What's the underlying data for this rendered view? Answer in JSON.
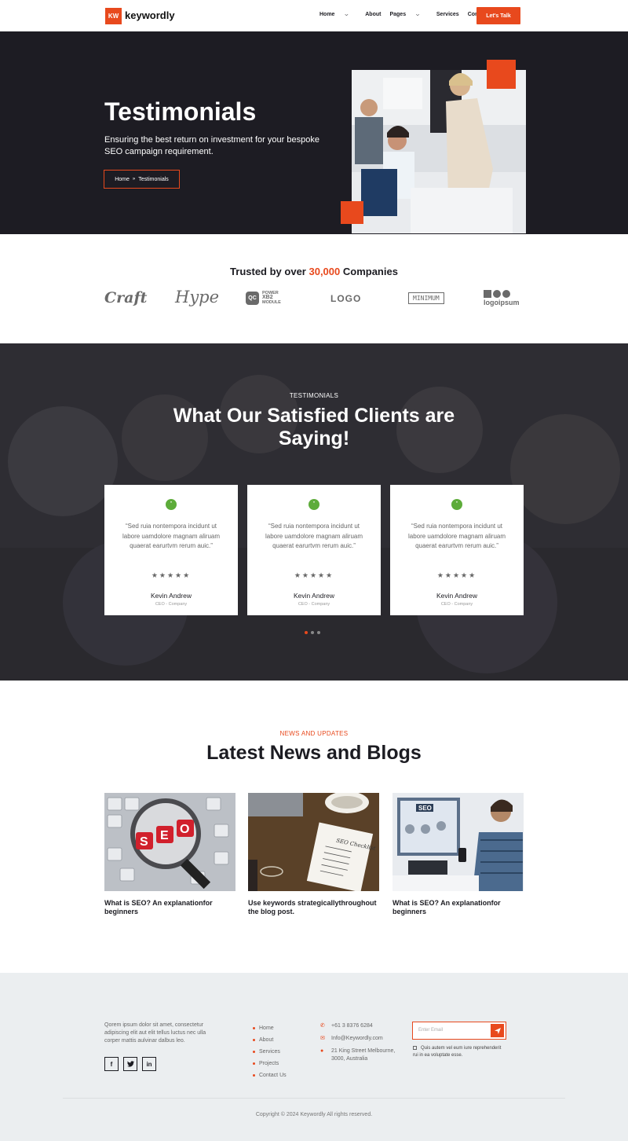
{
  "header": {
    "logo_mark": "KW",
    "logo_text": "keywordly",
    "nav": [
      "Home",
      "About",
      "Pages",
      "Services",
      "Contact"
    ],
    "cta": "Let's Talk"
  },
  "hero": {
    "title": "Testimonials",
    "subtitle": "Ensuring the best return on investment for your bespoke SEO campaign requirement.",
    "breadcrumb_home": "Home",
    "breadcrumb_sep": "»",
    "breadcrumb_current": "Testimonials"
  },
  "trusted": {
    "prefix": "Trusted by over",
    "number": "30,000",
    "suffix": "Companies"
  },
  "brands": [
    "Craft",
    "Hype",
    "QC",
    "POWER",
    "XB2",
    "MODULE",
    "LOGO",
    "MINIMUM",
    "logoipsum"
  ],
  "testimonials": {
    "eyebrow": "TESTIMONIALS",
    "title": "What Our Satisfied Clients are Saying!",
    "quote_mark": "”",
    "cards": [
      {
        "text": "“Sed ruia nontempora incidunt ut labore uamdolore magnam aliruam quaerat earurtvm rerum auic.”",
        "stars": "★★★★★",
        "name": "Kevin Andrew",
        "role": "CEO - Company"
      },
      {
        "text": "“Sed ruia nontempora incidunt ut labore uamdolore magnam aliruam quaerat earurtvm rerum auic.”",
        "stars": "★★★★★",
        "name": "Kevin Andrew",
        "role": "CEO - Company"
      },
      {
        "text": "“Sed ruia nontempora incidunt ut labore uamdolore magnam aliruam quaerat earurtvm rerum auic.”",
        "stars": "★★★★★",
        "name": "Kevin Andrew",
        "role": "CEO - Company"
      }
    ]
  },
  "news": {
    "eyebrow": "NEWS AND UPDATES",
    "title": "Latest News and Blogs",
    "posts": [
      {
        "title": "What is SEO? An explanationfor beginners",
        "image_text": "SEO"
      },
      {
        "title": "Use keywords strategicallythroughout the blog post.",
        "image_text": "SEO Checklist"
      },
      {
        "title": "What is SEO? An explanationfor beginners",
        "image_text": "SEO"
      }
    ]
  },
  "footer": {
    "about": "Qorem ipsum dolor sit amet, consectetur adipiscing elit aut elit tellus luctus nec ulla corper mattis aulvinar dalbus leo.",
    "social": [
      "f",
      "t",
      "in"
    ],
    "links": [
      "Home",
      "About",
      "Services",
      "Projects",
      "Contact Us"
    ],
    "phone": "+61 3 8376 6284",
    "email": "Info@Keywordly.com",
    "address": "21 King Street Melbourne, 3000, Australia",
    "newsletter_placeholder": "Enter Email",
    "consent": "Quis autem vel eum iure reprehenderit rui in ea voluptate esse.",
    "copyright": "Copyright © 2024 Keywordly All rights reserved."
  },
  "colors": {
    "accent": "#e8491d",
    "dark": "#1d1c23",
    "quote_green": "#5dac3a",
    "footer_bg": "#ebeef0"
  }
}
